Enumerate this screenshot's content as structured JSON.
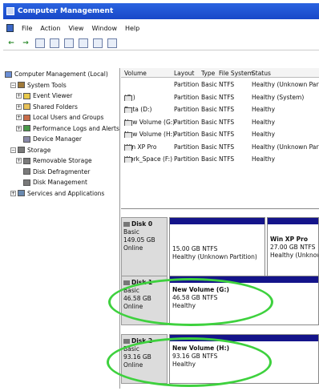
{
  "window": {
    "title": "Computer Management"
  },
  "menu": [
    "File",
    "Action",
    "View",
    "Window",
    "Help"
  ],
  "tree": [
    {
      "label": "Computer Management (Local)",
      "level": 0,
      "expander": "",
      "icon": "computer-icon",
      "cls": "pc"
    },
    {
      "label": "System Tools",
      "level": 1,
      "expander": "−",
      "icon": "tools-icon",
      "cls": "tool"
    },
    {
      "label": "Event Viewer",
      "level": 2,
      "expander": "+",
      "icon": "event-viewer-icon",
      "cls": "yellow"
    },
    {
      "label": "Shared Folders",
      "level": 2,
      "expander": "+",
      "icon": "shared-folder-icon",
      "cls": "folder"
    },
    {
      "label": "Local Users and Groups",
      "level": 2,
      "expander": "+",
      "icon": "users-icon",
      "cls": "users"
    },
    {
      "label": "Performance Logs and Alerts",
      "level": 2,
      "expander": "+",
      "icon": "performance-icon",
      "cls": "chart"
    },
    {
      "label": "Device Manager",
      "level": 2,
      "expander": "",
      "icon": "device-manager-icon",
      "cls": "dev"
    },
    {
      "label": "Storage",
      "level": 1,
      "expander": "−",
      "icon": "storage-icon",
      "cls": "disk"
    },
    {
      "label": "Removable Storage",
      "level": 2,
      "expander": "+",
      "icon": "removable-storage-icon",
      "cls": "disk"
    },
    {
      "label": "Disk Defragmenter",
      "level": 2,
      "expander": "",
      "icon": "defragmenter-icon",
      "cls": "disk"
    },
    {
      "label": "Disk Management",
      "level": 2,
      "expander": "",
      "icon": "disk-management-icon",
      "cls": "disk"
    },
    {
      "label": "Services and Applications",
      "level": 1,
      "expander": "+",
      "icon": "services-icon",
      "cls": "apps"
    }
  ],
  "volume_table": {
    "columns": [
      "Volume",
      "Layout",
      "Type",
      "File System",
      "Status"
    ],
    "rows": [
      [
        "",
        "Partition",
        "Basic",
        "NTFS",
        "Healthy (Unknown Partition)"
      ],
      [
        "(C:)",
        "Partition",
        "Basic",
        "NTFS",
        "Healthy (System)"
      ],
      [
        "Data (D:)",
        "Partition",
        "Basic",
        "NTFS",
        "Healthy"
      ],
      [
        "New Volume (G:)",
        "Partition",
        "Basic",
        "NTFS",
        "Healthy"
      ],
      [
        "New Volume (H:)",
        "Partition",
        "Basic",
        "NTFS",
        "Healthy"
      ],
      [
        "Win XP Pro",
        "Partition",
        "Basic",
        "NTFS",
        "Healthy (Unknown Partition)"
      ],
      [
        "Work_Space (F:)",
        "Partition",
        "Basic",
        "NTFS",
        "Healthy"
      ]
    ]
  },
  "disks": [
    {
      "name": "Disk 0",
      "type": "Basic",
      "size": "149.05 GB",
      "status": "Online",
      "partitions": [
        {
          "name": "",
          "size": "15.00 GB NTFS",
          "status": "Healthy (Unknown Partition)"
        },
        {
          "name": "Win XP Pro",
          "size": "27.00 GB NTFS",
          "status": "Healthy (Unknown"
        }
      ]
    },
    {
      "name": "Disk 1",
      "type": "Basic",
      "size": "46.58 GB",
      "status": "Online",
      "partitions": [
        {
          "name": "New Volume (G:)",
          "size": "46.58 GB NTFS",
          "status": "Healthy"
        }
      ]
    },
    {
      "name": "Disk 2",
      "type": "Basic",
      "size": "93.16 GB",
      "status": "Online",
      "partitions": [
        {
          "name": "New Volume (H:)",
          "size": "93.16 GB NTFS",
          "status": "Healthy"
        }
      ]
    }
  ],
  "colors": {
    "titlebar": "#1f55d6",
    "partition_header": "#14148a",
    "highlight": "#3ed13e"
  }
}
